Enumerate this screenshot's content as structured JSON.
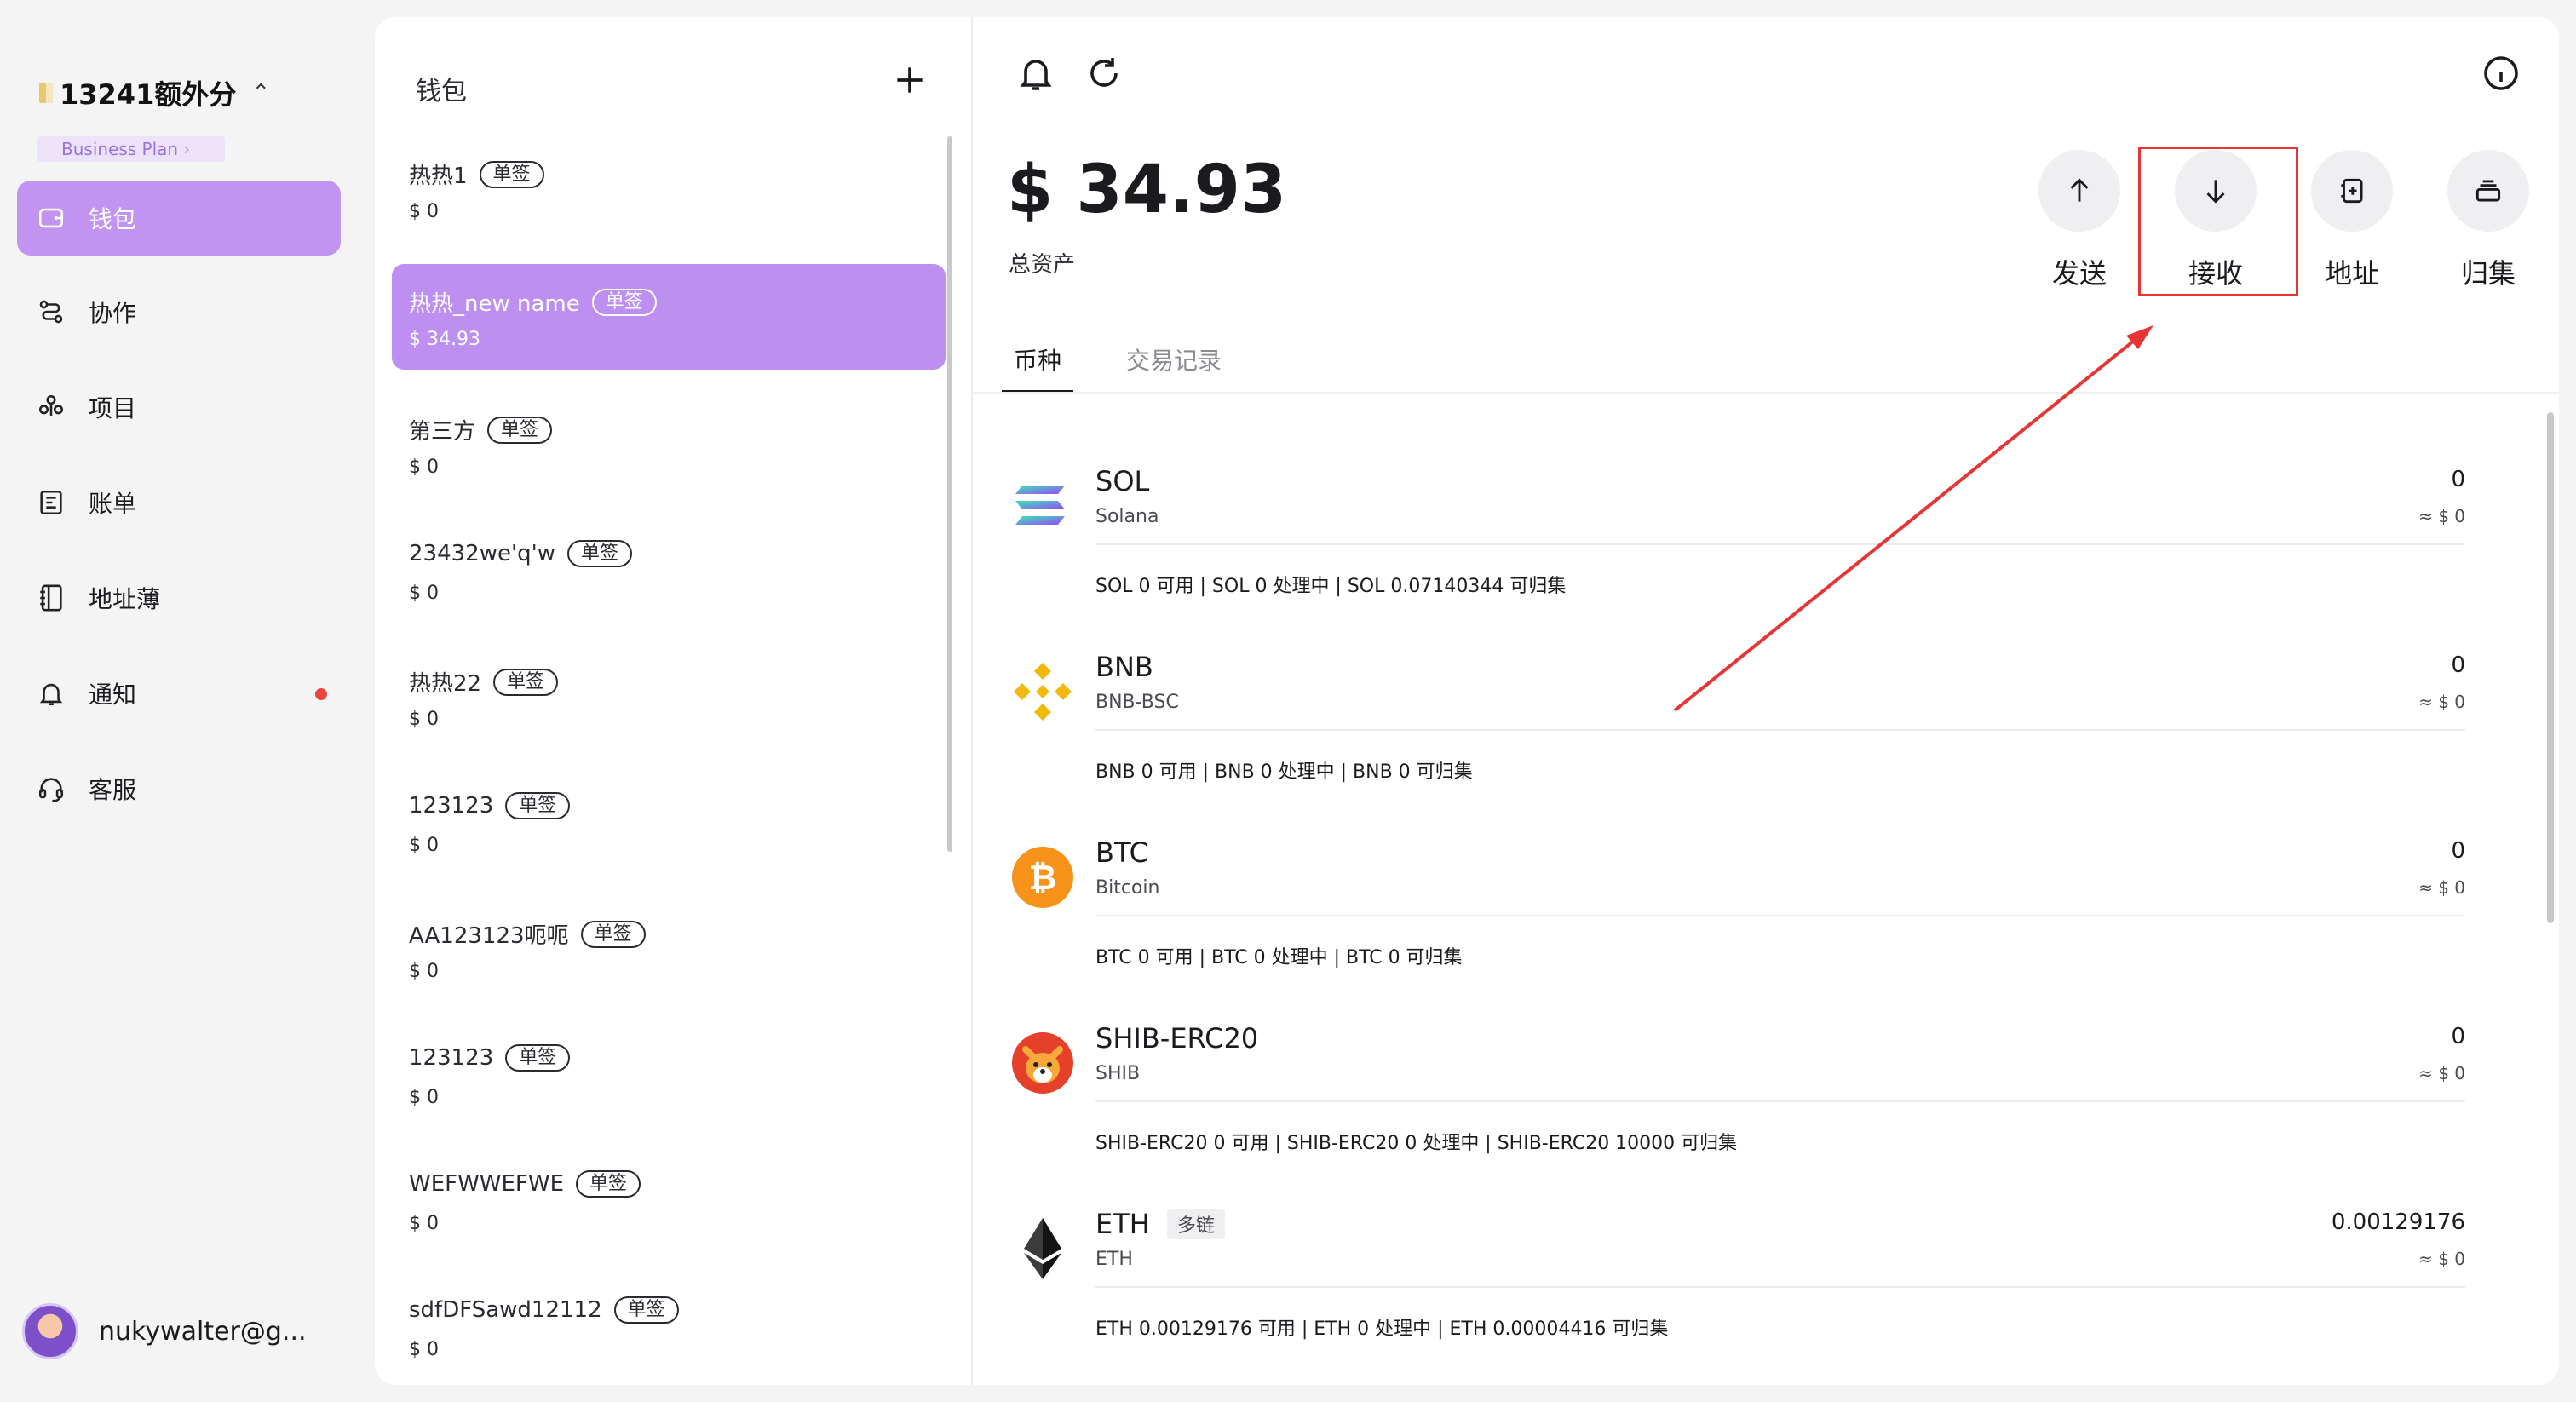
{
  "sidebar": {
    "org_name": "13241额外分",
    "plan_label": "Business Plan",
    "plan_arrow": "›",
    "nav": [
      {
        "label": "钱包",
        "icon": "wallet-icon"
      },
      {
        "label": "协作",
        "icon": "collaboration-icon"
      },
      {
        "label": "项目",
        "icon": "project-icon"
      },
      {
        "label": "账单",
        "icon": "bill-icon"
      },
      {
        "label": "地址薄",
        "icon": "address-book-icon"
      },
      {
        "label": "通知",
        "icon": "bell-icon"
      },
      {
        "label": "客服",
        "icon": "headset-icon"
      }
    ],
    "user_email": "nukywalter@g..."
  },
  "wallets": {
    "title": "钱包",
    "items": [
      {
        "name": "热热1",
        "tag": "单签",
        "balance": "$ 0"
      },
      {
        "name": "热热_new name",
        "tag": "单签",
        "balance": "$ 34.93"
      },
      {
        "name": "第三方",
        "tag": "单签",
        "balance": "$ 0"
      },
      {
        "name": "23432we'q'w",
        "tag": "单签",
        "balance": "$ 0"
      },
      {
        "name": "热热22",
        "tag": "单签",
        "balance": "$ 0"
      },
      {
        "name": "123123",
        "tag": "单签",
        "balance": "$ 0"
      },
      {
        "name": "AA123123呃呃",
        "tag": "单签",
        "balance": "$ 0"
      },
      {
        "name": "123123",
        "tag": "单签",
        "balance": "$ 0"
      },
      {
        "name": "WEFWWEFWE",
        "tag": "单签",
        "balance": "$ 0"
      },
      {
        "name": "sdfDFSawd12112",
        "tag": "单签",
        "balance": "$ 0"
      }
    ]
  },
  "main": {
    "total": "$ 34.93",
    "total_label": "总资产",
    "actions": {
      "send": "发送",
      "receive": "接收",
      "address": "地址",
      "collect": "归集"
    },
    "tabs": {
      "currency": "币种",
      "transactions": "交易记录"
    },
    "assets": [
      {
        "symbol": "SOL",
        "name": "Solana",
        "tag": "",
        "amount": "0",
        "usd": "≈ $ 0",
        "detail": "SOL 0 可用  |  SOL 0 处理中  |  SOL 0.07140344 可归集"
      },
      {
        "symbol": "BNB",
        "name": "BNB-BSC",
        "tag": "",
        "amount": "0",
        "usd": "≈ $ 0",
        "detail": "BNB 0 可用  |  BNB 0 处理中  |  BNB 0 可归集"
      },
      {
        "symbol": "BTC",
        "name": "Bitcoin",
        "tag": "",
        "amount": "0",
        "usd": "≈ $ 0",
        "detail": "BTC 0 可用  |  BTC 0 处理中  |  BTC 0 可归集"
      },
      {
        "symbol": "SHIB-ERC20",
        "name": "SHIB",
        "tag": "",
        "amount": "0",
        "usd": "≈ $ 0",
        "detail": "SHIB-ERC20 0 可用  |  SHIB-ERC20 0 处理中  |  SHIB-ERC20 10000 可归集"
      },
      {
        "symbol": "ETH",
        "name": "ETH",
        "tag": "多链",
        "amount": "0.00129176",
        "usd": "≈ $ 0",
        "detail": "ETH 0.00129176 可用  |  ETH 0 处理中  |  ETH 0.00004416 可归集"
      }
    ]
  },
  "colors": {
    "accent": "#c194f2",
    "highlight": "#e53535"
  }
}
